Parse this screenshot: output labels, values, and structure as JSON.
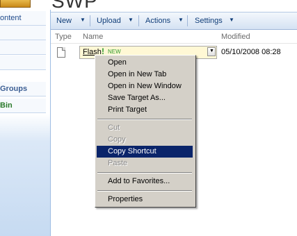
{
  "page": {
    "title": "SWP"
  },
  "leftnav": {
    "items": [
      {
        "label": "ontent"
      },
      {
        "label": ""
      },
      {
        "label": ""
      },
      {
        "label": ""
      },
      {
        "label": "Groups"
      },
      {
        "label": "Bin"
      }
    ]
  },
  "toolbar": {
    "buttons": [
      {
        "label": "New"
      },
      {
        "label": "Upload"
      },
      {
        "label": "Actions"
      },
      {
        "label": "Settings"
      }
    ]
  },
  "list": {
    "headers": {
      "type": "Type",
      "name": "Name",
      "modified": "Modified"
    },
    "row": {
      "name": "Flash",
      "new_mark": "!",
      "new_tag": "NEW",
      "modified": "05/10/2008 08:28"
    }
  },
  "context_menu": {
    "items": [
      {
        "label": "Open",
        "disabled": false,
        "selected": false
      },
      {
        "label": "Open in New Tab",
        "disabled": false,
        "selected": false
      },
      {
        "label": "Open in New Window",
        "disabled": false,
        "selected": false
      },
      {
        "label": "Save Target As...",
        "disabled": false,
        "selected": false
      },
      {
        "label": "Print Target",
        "disabled": false,
        "selected": false
      },
      {
        "label": "Cut",
        "disabled": true,
        "selected": false
      },
      {
        "label": "Copy",
        "disabled": true,
        "selected": false
      },
      {
        "label": "Copy Shortcut",
        "disabled": false,
        "selected": true
      },
      {
        "label": "Paste",
        "disabled": true,
        "selected": false
      },
      {
        "label": "Add to Favorites...",
        "disabled": false,
        "selected": false
      },
      {
        "label": "Properties",
        "disabled": false,
        "selected": false
      }
    ]
  },
  "colors": {
    "accent": "#0f3d78",
    "menu_highlight": "#0a246a",
    "menu_bg": "#d4d0c8",
    "new_green": "#2f9a2f"
  }
}
